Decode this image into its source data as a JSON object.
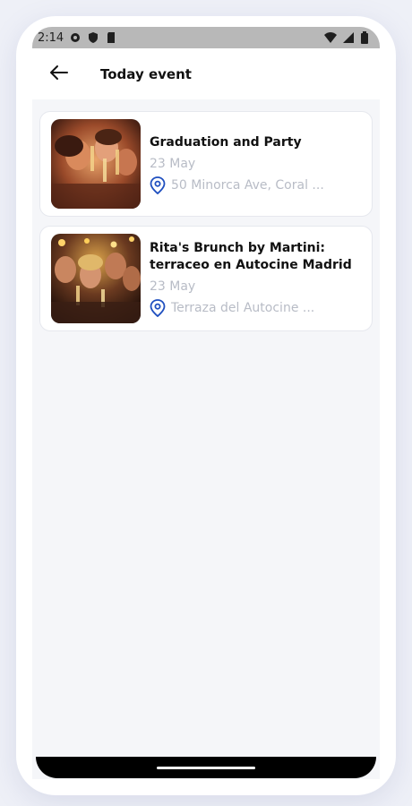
{
  "status_bar": {
    "time": "2:14"
  },
  "app_bar": {
    "title": "Today event"
  },
  "events": [
    {
      "title": "Graduation and Party",
      "date": "23 May",
      "location": "50 Minorca Ave, Coral ..."
    },
    {
      "title": "Rita's Brunch by Martini: terraceo en Autocine Madrid",
      "date": "23 May",
      "location": "Terraza del Autocine ..."
    }
  ],
  "colors": {
    "accent": "#1f4fbf",
    "muted": "#b8bcc6",
    "background": "#f5f6f9"
  },
  "icons": {
    "back": "arrow-left-icon",
    "location": "location-pin-icon"
  }
}
